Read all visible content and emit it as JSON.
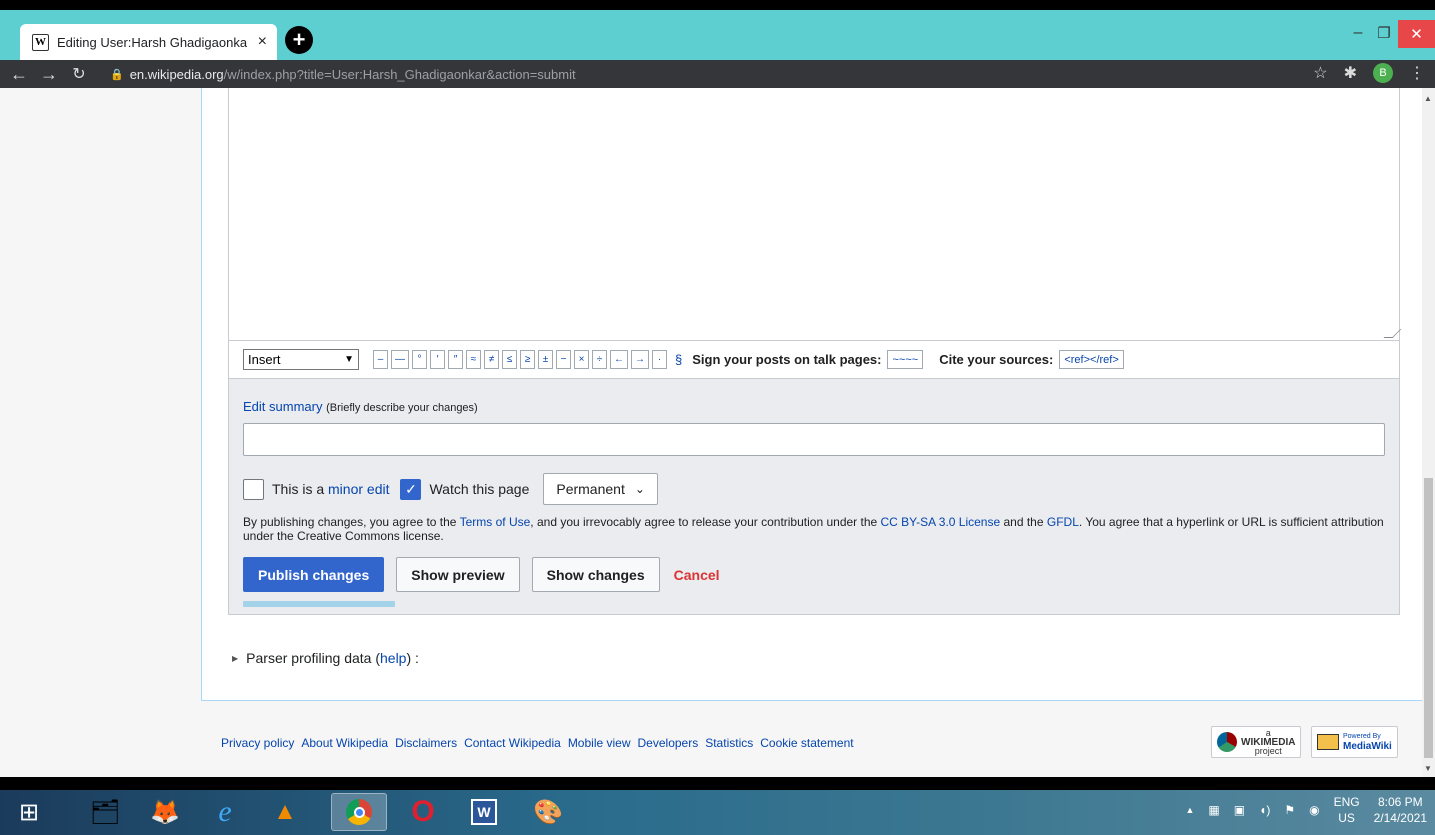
{
  "browser": {
    "tab_title": "Editing User:Harsh Ghadigaonkar",
    "tab_favicon": "W",
    "tab_close": "×",
    "new_tab": "+",
    "window_minimize": "–",
    "window_maximize": "❐",
    "window_close": "✕",
    "url_host": "en.wikipedia.org",
    "url_path": "/w/index.php?title=User:Harsh_Ghadigaonkar&action=submit",
    "profile_initial": "B"
  },
  "toolbar": {
    "insert_label": "Insert",
    "characters": [
      "–",
      "—",
      "°",
      "′",
      "″",
      "≈",
      "≠",
      "≤",
      "≥",
      "±",
      "−",
      "×",
      "÷",
      "←",
      "→",
      "·"
    ],
    "section_sign": "§",
    "sign_label": "Sign your posts on talk pages:",
    "sign_code": "~~~~",
    "cite_label": "Cite your sources:",
    "cite_code": "<ref></ref>"
  },
  "summary": {
    "label": "Edit summary",
    "hint": "(Briefly describe your changes)",
    "value": ""
  },
  "options": {
    "minor_prefix": "This is a ",
    "minor_link": "minor edit",
    "minor_checked": false,
    "watch_label": "Watch this page",
    "watch_checked": true,
    "watch_period": "Permanent"
  },
  "legal": {
    "t1": "By publishing changes, you agree to the ",
    "terms": "Terms of Use",
    "t2": ", and you irrevocably agree to release your contribution under the ",
    "license": "CC BY-SA 3.0 License",
    "t3": " and the ",
    "gfdl": "GFDL",
    "t4": ". You agree that a hyperlink or URL is sufficient attribution under the Creative Commons license."
  },
  "buttons": {
    "publish": "Publish changes",
    "preview": "Show preview",
    "changes": "Show changes",
    "cancel": "Cancel"
  },
  "parser": {
    "label": "Parser profiling data (",
    "help": "help",
    "suffix": ") :"
  },
  "footer": {
    "links": [
      "Privacy policy",
      "About Wikipedia",
      "Disclaimers",
      "Contact Wikipedia",
      "Mobile view",
      "Developers",
      "Statistics",
      "Cookie statement"
    ],
    "wikimedia_top": "a",
    "wikimedia_name": "WIKIMEDIA",
    "wikimedia_sub": "project",
    "mediawiki_top": "Powered By",
    "mediawiki_name": "MediaWiki"
  },
  "taskbar": {
    "lang_top": "ENG",
    "lang_bottom": "US",
    "time": "8:06 PM",
    "date": "2/14/2021"
  },
  "colors": {
    "tab_strip": "#5ecfd0",
    "primary": "#3366cc",
    "link": "#0645ad",
    "cancel": "#d33"
  }
}
